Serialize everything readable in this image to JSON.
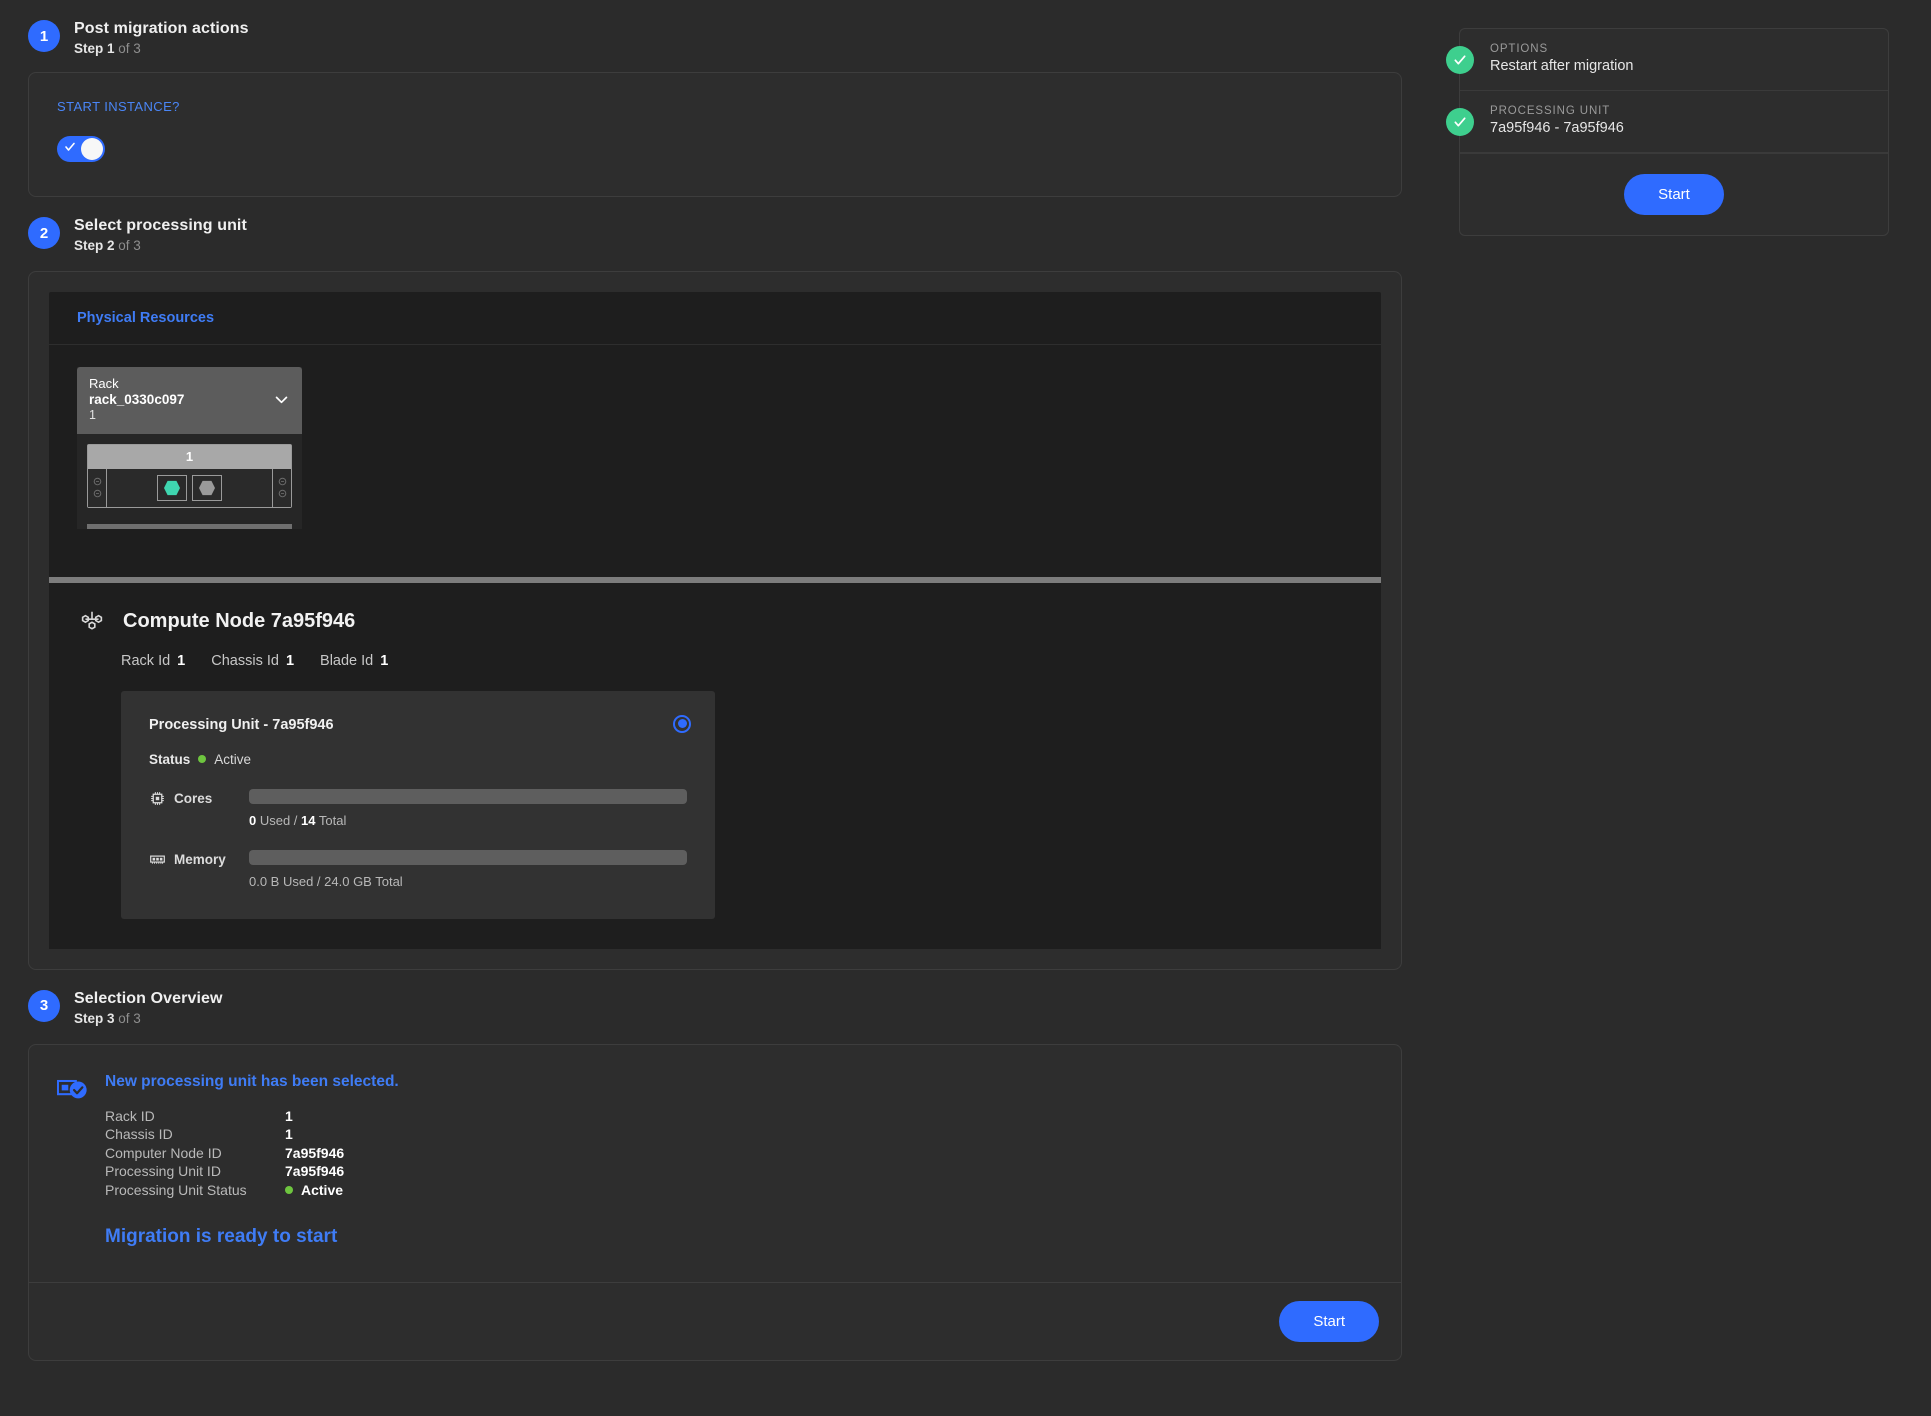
{
  "theme": {
    "background": "#2b2b2b",
    "card": "#2d2d2d",
    "panel": "#1e1e1e",
    "accent_blue": "#2f6bff",
    "link_blue": "#3f7cf5",
    "green_check": "#3ecf8e",
    "status_green": "#6ec53f",
    "teal_blade": "#3fd6b0",
    "gray_blade": "#9a9a9a"
  },
  "steps": {
    "one": {
      "number": "1",
      "title": "Post migration actions",
      "step_label": "Step 1",
      "step_of": " of 3",
      "field_label": "START INSTANCE?",
      "toggle_on": true
    },
    "two": {
      "number": "2",
      "title": "Select processing unit",
      "step_label": "Step 2",
      "step_of": " of 3",
      "panel_title": "Physical Resources",
      "rack": {
        "kind_label": "Rack",
        "name": "rack_0330c097",
        "number": "1",
        "chassis_label": "1",
        "blades": [
          {
            "name": "blade-slot-active",
            "state": "active"
          },
          {
            "name": "blade-slot-idle",
            "state": "idle"
          }
        ]
      },
      "node": {
        "title": "Compute Node 7a95f946",
        "rack_id_label": "Rack Id",
        "rack_id_value": "1",
        "chassis_id_label": "Chassis Id",
        "chassis_id_value": "1",
        "blade_id_label": "Blade Id",
        "blade_id_value": "1"
      },
      "processing_unit": {
        "title": "Processing Unit - 7a95f946",
        "selected": true,
        "status_label": "Status",
        "status_value": "Active",
        "cores": {
          "label": "Cores",
          "used": "0",
          "used_suffix": " Used / ",
          "total": "14",
          "total_suffix": " Total",
          "text": "0 Used / 14 Total",
          "percent": 0
        },
        "memory": {
          "label": "Memory",
          "text": "0.0 B Used / 24.0 GB Total",
          "percent": 0
        }
      }
    },
    "three": {
      "number": "3",
      "title": "Selection Overview",
      "step_label": "Step 3",
      "step_of": " of 3",
      "headline": "New processing unit has been selected.",
      "details": [
        {
          "key": "Rack ID",
          "value": "1",
          "status": false
        },
        {
          "key": "Chassis ID",
          "value": "1",
          "status": false
        },
        {
          "key": "Computer Node ID",
          "value": "7a95f946",
          "status": false
        },
        {
          "key": "Processing Unit ID",
          "value": "7a95f946",
          "status": false
        },
        {
          "key": "Processing Unit Status",
          "value": "Active",
          "status": true
        }
      ],
      "ready_text": "Migration is ready to start",
      "start_label": "Start"
    }
  },
  "summary": {
    "rows": [
      {
        "key": "OPTIONS",
        "value": "Restart after migration"
      },
      {
        "key": "PROCESSING UNIT",
        "value": "7a95f946 - 7a95f946"
      }
    ],
    "start_label": "Start"
  }
}
